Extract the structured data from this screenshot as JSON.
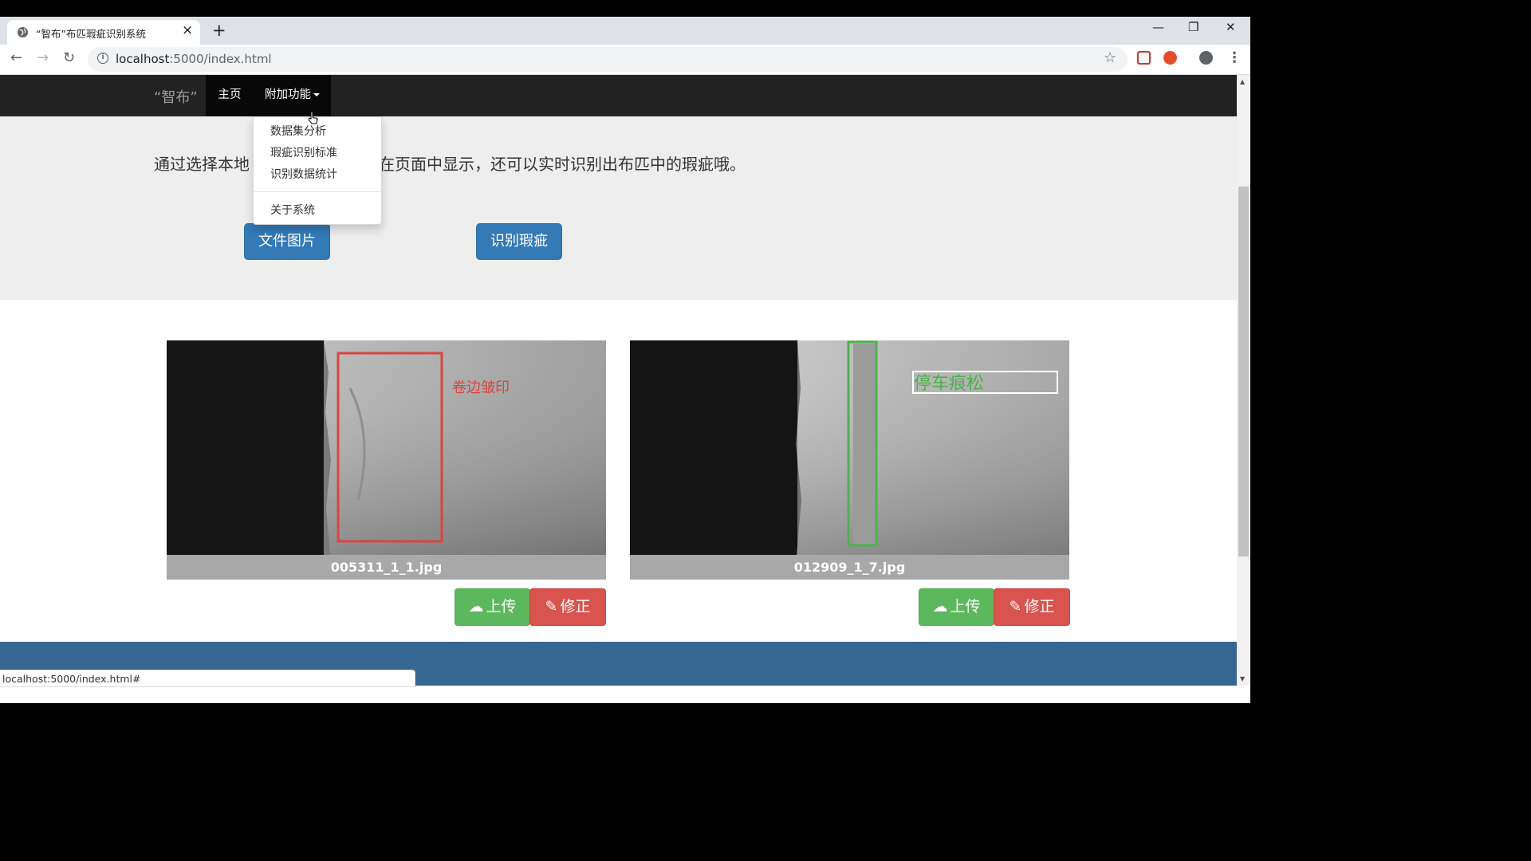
{
  "browser": {
    "tab_title": "“智布”布匹瑕疵识别系统",
    "url_host": "localhost",
    "url_rest": ":5000/index.html",
    "status_url": "localhost:5000/index.html#"
  },
  "navbar": {
    "brand": "“智布”",
    "home": "主页",
    "extra": "附加功能"
  },
  "dropdown": {
    "items": [
      "数据集分析",
      "瑕疵识别标准",
      "识别数据统计"
    ],
    "about": "关于系统"
  },
  "jumbotron": {
    "lead_left": "通过选择本地",
    "lead_right": "在页面中显示，还可以实时识别出布匹中的瑕疵哦。",
    "file_button": "文件图片",
    "detect_button": "识别瑕疵"
  },
  "results": [
    {
      "filename": "005311_1_1.jpg",
      "label": "卷边皱印",
      "box_color": "#d9453f",
      "upload": "上传",
      "fix": "修正"
    },
    {
      "filename": "012909_1_7.jpg",
      "label": "停车痕松",
      "box_color": "#4cb34c",
      "upload": "上传",
      "fix": "修正"
    }
  ],
  "colors": {
    "navbar": "#222222",
    "primary": "#337ab7",
    "success": "#5cb85c",
    "danger": "#d9534f",
    "footer": "#376791"
  }
}
